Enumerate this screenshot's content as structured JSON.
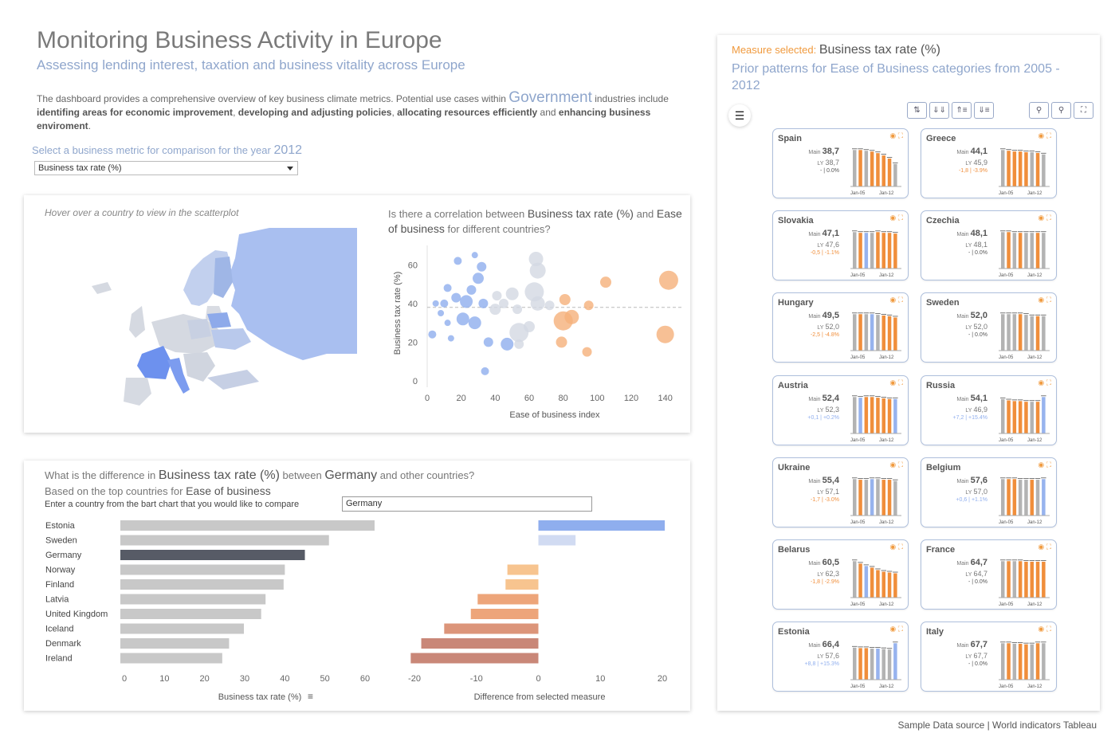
{
  "header": {
    "title": "Monitoring Business Activity in Europe",
    "subtitle": "Assessing lending interest, taxation and business vitality across Europe",
    "desc_1": "The dashboard provides a comprehensive overview of key business climate metrics. Potential use cases within",
    "desc_highlight": "Government",
    "desc_2": "industries include",
    "desc_bold_1": "identifing areas for economic improvement",
    "desc_sep_1": ",",
    "desc_bold_2": "developing and adjusting policies",
    "desc_sep_2": ",",
    "desc_bold_3": "allocating resources efficiently",
    "desc_and": "and",
    "desc_bold_4": "enhancing business enviroment",
    "desc_end": "."
  },
  "selector": {
    "label": "Select a business metric for comparison for the year",
    "year": "2012",
    "value": "Business tax rate (%)"
  },
  "map": {
    "hint": "Hover over a country to view in the scatterplot"
  },
  "scatter": {
    "q_prefix": "Is there a correlation between",
    "q_measure": "Business tax rate (%)",
    "q_and": "and",
    "q_measure2": "Ease of business",
    "q_suffix": "for different countries?"
  },
  "compare": {
    "q_prefix": "What is the difference in",
    "q_measure": "Business tax rate (%)",
    "q_between": "between",
    "q_country": "Germany",
    "q_suffix": "and other countries?",
    "sub_prefix": "Based on the top countries for",
    "sub_bold": "Ease of business",
    "enter_label": "Enter a country from the bart chart that you would like to compare",
    "input_value": "Germany"
  },
  "right_panel": {
    "measure_label": "Measure selected:",
    "measure_value": "Business tax rate (%)",
    "title": "Prior patterns for Ease of Business categories from 2005 - 2012",
    "main_label": "Main",
    "ly_label": "LY",
    "x_start": "Jan-05",
    "x_end": "Jan-12",
    "cards": [
      {
        "name": "Spain",
        "main": "38,7",
        "ly": "38,7",
        "chg": "- | 0.0%",
        "dir": "flat",
        "vals": [
          47,
          47,
          46,
          45,
          43,
          40,
          36,
          29
        ],
        "colors": "gogoooog"
      },
      {
        "name": "Greece",
        "main": "44,1",
        "ly": "45,9",
        "chg": "-1,8 | -3.9%",
        "dir": "down",
        "vals": [
          50,
          49,
          48,
          48,
          47,
          47,
          46,
          44
        ],
        "colors": "goooogog"
      },
      {
        "name": "Slovakia",
        "main": "47,1",
        "ly": "47,6",
        "chg": "-0,5 | -1.1%",
        "dir": "down",
        "vals": [
          49,
          48,
          48,
          48,
          49,
          48,
          48,
          47
        ],
        "colors": "gobgoooo"
      },
      {
        "name": "Czechia",
        "main": "48,1",
        "ly": "48,1",
        "chg": "- | 0.0%",
        "dir": "flat",
        "vals": [
          49,
          49,
          48,
          48,
          48,
          48,
          48,
          48
        ],
        "colors": "gogoggog"
      },
      {
        "name": "Hungary",
        "main": "49,5",
        "ly": "52,0",
        "chg": "-2,5 | -4.8%",
        "dir": "down",
        "vals": [
          55,
          55,
          55,
          55,
          54,
          53,
          52,
          50
        ],
        "colors": "gogbgooo"
      },
      {
        "name": "Sweden",
        "main": "52,0",
        "ly": "52,0",
        "chg": "- | 0.0%",
        "dir": "flat",
        "vals": [
          55,
          55,
          55,
          55,
          54,
          52,
          52,
          52
        ],
        "colors": "gggoggog"
      },
      {
        "name": "Austria",
        "main": "52,4",
        "ly": "52,3",
        "chg": "+0,1 | +0.2%",
        "dir": "up",
        "vals": [
          55,
          54,
          55,
          55,
          54,
          53,
          52,
          52
        ],
        "colors": "gbooooob"
      },
      {
        "name": "Russia",
        "main": "54,1",
        "ly": "46,9",
        "chg": "+7,2 | +15.4%",
        "dir": "up",
        "vals": [
          51,
          49,
          48,
          48,
          47,
          47,
          47,
          54
        ],
        "colors": "goooogob"
      },
      {
        "name": "Ukraine",
        "main": "55,4",
        "ly": "57,1",
        "chg": "-1,7 | -3.0%",
        "dir": "down",
        "vals": [
          58,
          57,
          57,
          58,
          58,
          57,
          57,
          55
        ],
        "colors": "gogbgoog"
      },
      {
        "name": "Belgium",
        "main": "57,6",
        "ly": "57,0",
        "chg": "+0,6 | +1.1%",
        "dir": "up",
        "vals": [
          58,
          58,
          58,
          57,
          57,
          57,
          57,
          58
        ],
        "colors": "googgogb"
      },
      {
        "name": "Belarus",
        "main": "60,5",
        "ly": "62,3",
        "chg": "-1,8 | -2.9%",
        "dir": "down",
        "vals": [
          90,
          84,
          78,
          74,
          68,
          64,
          62,
          60
        ],
        "colors": "gobooooo"
      },
      {
        "name": "France",
        "main": "64,7",
        "ly": "64,7",
        "chg": "- | 0.0%",
        "dir": "flat",
        "vals": [
          66,
          66,
          66,
          66,
          65,
          65,
          65,
          65
        ],
        "colors": "gogooooo"
      },
      {
        "name": "Estonia",
        "main": "66,4",
        "ly": "57,6",
        "chg": "+8,8 | +15.3%",
        "dir": "up",
        "vals": [
          66,
          65,
          65,
          64,
          64,
          63,
          62,
          75
        ],
        "colors": "googbggb"
      },
      {
        "name": "Italy",
        "main": "67,7",
        "ly": "67,7",
        "chg": "- | 0.0%",
        "dir": "flat",
        "vals": [
          68,
          68,
          67,
          67,
          66,
          66,
          68,
          68
        ],
        "colors": "gogoogog"
      }
    ]
  },
  "footer": "Sample Data source | World indicators  Tableau",
  "colors": {
    "accent_blue": "#8fa6cc",
    "orange": "#f09a3e",
    "bar_grey": "#c8c8c8",
    "bar_dark": "#575b66",
    "diff_blue": "#8faeee"
  },
  "chart_data": [
    {
      "type": "scatter",
      "title": "",
      "xlabel": "Ease of business index",
      "ylabel": "Business tax rate (%)",
      "xlim": [
        0,
        150
      ],
      "ylim": [
        0,
        70
      ],
      "xticks": [
        "0",
        "20",
        "40",
        "60",
        "80",
        "100",
        "120",
        "140"
      ],
      "yticks": [
        "0",
        "20",
        "40",
        "60"
      ],
      "points": [
        {
          "x": 18,
          "y": 62,
          "s": 5,
          "c": "b"
        },
        {
          "x": 28,
          "y": 65,
          "s": 4,
          "c": "b"
        },
        {
          "x": 32,
          "y": 59,
          "s": 6,
          "c": "b"
        },
        {
          "x": 30,
          "y": 53,
          "s": 7,
          "c": "b"
        },
        {
          "x": 12,
          "y": 48,
          "s": 5,
          "c": "b"
        },
        {
          "x": 17,
          "y": 43,
          "s": 6,
          "c": "b"
        },
        {
          "x": 23,
          "y": 41,
          "s": 8,
          "c": "b"
        },
        {
          "x": 26,
          "y": 47,
          "s": 6,
          "c": "b"
        },
        {
          "x": 5,
          "y": 40,
          "s": 4,
          "c": "b"
        },
        {
          "x": 10,
          "y": 40,
          "s": 5,
          "c": "b"
        },
        {
          "x": 8,
          "y": 35,
          "s": 4,
          "c": "b"
        },
        {
          "x": 12,
          "y": 30,
          "s": 4,
          "c": "b"
        },
        {
          "x": 3,
          "y": 24,
          "s": 5,
          "c": "b"
        },
        {
          "x": 14,
          "y": 22,
          "s": 4,
          "c": "b"
        },
        {
          "x": 21,
          "y": 32,
          "s": 8,
          "c": "b"
        },
        {
          "x": 28,
          "y": 30,
          "s": 8,
          "c": "b"
        },
        {
          "x": 33,
          "y": 40,
          "s": 6,
          "c": "b"
        },
        {
          "x": 36,
          "y": 20,
          "s": 6,
          "c": "b"
        },
        {
          "x": 47,
          "y": 19,
          "s": 8,
          "c": "b"
        },
        {
          "x": 34,
          "y": 5,
          "s": 5,
          "c": "b"
        },
        {
          "x": 40,
          "y": 37,
          "s": 7,
          "c": "g"
        },
        {
          "x": 45,
          "y": 40,
          "s": 6,
          "c": "g"
        },
        {
          "x": 41,
          "y": 44,
          "s": 6,
          "c": "g"
        },
        {
          "x": 50,
          "y": 45,
          "s": 8,
          "c": "g"
        },
        {
          "x": 53,
          "y": 37,
          "s": 6,
          "c": "g"
        },
        {
          "x": 54,
          "y": 25,
          "s": 12,
          "c": "g"
        },
        {
          "x": 54,
          "y": 19,
          "s": 6,
          "c": "g"
        },
        {
          "x": 60,
          "y": 28,
          "s": 7,
          "c": "g"
        },
        {
          "x": 65,
          "y": 57,
          "s": 10,
          "c": "g"
        },
        {
          "x": 63,
          "y": 46,
          "s": 12,
          "c": "g"
        },
        {
          "x": 65,
          "y": 40,
          "s": 9,
          "c": "g"
        },
        {
          "x": 64,
          "y": 63,
          "s": 9,
          "c": "g"
        },
        {
          "x": 72,
          "y": 39,
          "s": 6,
          "c": "g"
        },
        {
          "x": 81,
          "y": 42,
          "s": 7,
          "c": "o"
        },
        {
          "x": 85,
          "y": 33,
          "s": 9,
          "c": "o"
        },
        {
          "x": 80,
          "y": 31,
          "s": 12,
          "c": "o"
        },
        {
          "x": 79,
          "y": 20,
          "s": 7,
          "c": "o"
        },
        {
          "x": 95,
          "y": 39,
          "s": 6,
          "c": "o"
        },
        {
          "x": 94,
          "y": 15,
          "s": 6,
          "c": "o"
        },
        {
          "x": 105,
          "y": 51,
          "s": 7,
          "c": "o"
        },
        {
          "x": 140,
          "y": 24,
          "s": 11,
          "c": "o"
        },
        {
          "x": 142,
          "y": 52,
          "s": 12,
          "c": "o"
        }
      ],
      "ref_line_y": 38
    },
    {
      "type": "bar",
      "xlabel": "Business tax rate (%)",
      "xlim": [
        0,
        60
      ],
      "xticks": [
        "0",
        "10",
        "20",
        "30",
        "40",
        "50",
        "60"
      ],
      "categories": [
        "Estonia",
        "Sweden",
        "Germany",
        "Norway",
        "Finland",
        "Latvia",
        "United Kingdom",
        "Iceland",
        "Denmark",
        "Ireland"
      ],
      "values": [
        66.4,
        52.0,
        46.0,
        41.0,
        40.7,
        36.2,
        35.1,
        30.8,
        27.1,
        25.4
      ],
      "highlight": "Germany"
    },
    {
      "type": "bar",
      "xlabel": "Difference from selected measure",
      "xlim": [
        -20,
        20
      ],
      "xticks": [
        "-20",
        "-10",
        "0",
        "10",
        "20"
      ],
      "categories": [
        "Estonia",
        "Sweden",
        "Germany",
        "Norway",
        "Finland",
        "Latvia",
        "United Kingdom",
        "Iceland",
        "Denmark",
        "Ireland"
      ],
      "values": [
        20.4,
        6.0,
        0,
        -5.0,
        -5.3,
        -9.8,
        -10.9,
        -15.2,
        -18.9,
        -20.6
      ]
    }
  ]
}
